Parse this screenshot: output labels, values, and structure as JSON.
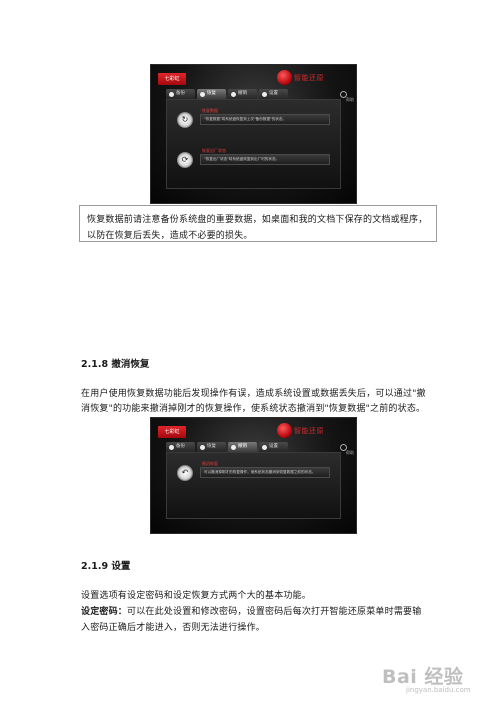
{
  "screenshot1": {
    "brand": "七彩虹",
    "app_title": "智能还原",
    "tabs": [
      {
        "label": "备份"
      },
      {
        "label": "恢复"
      },
      {
        "label": "撤销"
      },
      {
        "label": "设置"
      }
    ],
    "help_label": "帮助",
    "rows": [
      {
        "title": "恢复数据",
        "desc": "\"恢复数据\"将系统盘恢复到上次\"备份数据\"的状态。"
      },
      {
        "title": "恢复出厂状态",
        "desc": "\"恢复出厂状态\"将系统盘恢复到出厂时的状态。"
      }
    ]
  },
  "paragraph1": {
    "lines": [
      "恢复数据前请注意备份系统盘的重要数据，如桌面和我的文档下保存的文档或程序，",
      "以防在恢复后丢失，造成不必要的损失。"
    ]
  },
  "section_218": {
    "heading": "2.1.8 撤消恢复",
    "lines": [
      "在用户使用恢复数据功能后发现操作有误，造成系统设置或数据丢失后，可以通过\"撤",
      "消恢复\"的功能来撤消掉刚才的恢复操作，使系统状态撤消到\"恢复数据\"之前的状态。"
    ]
  },
  "screenshot2": {
    "brand": "七彩虹",
    "app_title": "智能还原",
    "tabs": [
      {
        "label": "备份"
      },
      {
        "label": "恢复"
      },
      {
        "label": "撤销"
      },
      {
        "label": "设置"
      }
    ],
    "help_label": "帮助",
    "rows": [
      {
        "title": "撤消恢复",
        "desc": "可以撤消掉刚才的恢复操作，使系统状态撤消到恢复数据之前的状态。"
      }
    ]
  },
  "section_219": {
    "heading": "2.1.9 设置",
    "intro": "设置选项有设定密码和设定恢复方式两个大的基本功能。",
    "password_label": "设定密码：",
    "password_text": "可以在此处设置和修改密码，设置密码后每次打开智能还原菜单时需要输",
    "password_text2": "入密码正确后才能进入，否则无法进行操作。"
  },
  "watermark": {
    "main": "Bai 经验",
    "sub": "jingyan.baidu.com"
  }
}
